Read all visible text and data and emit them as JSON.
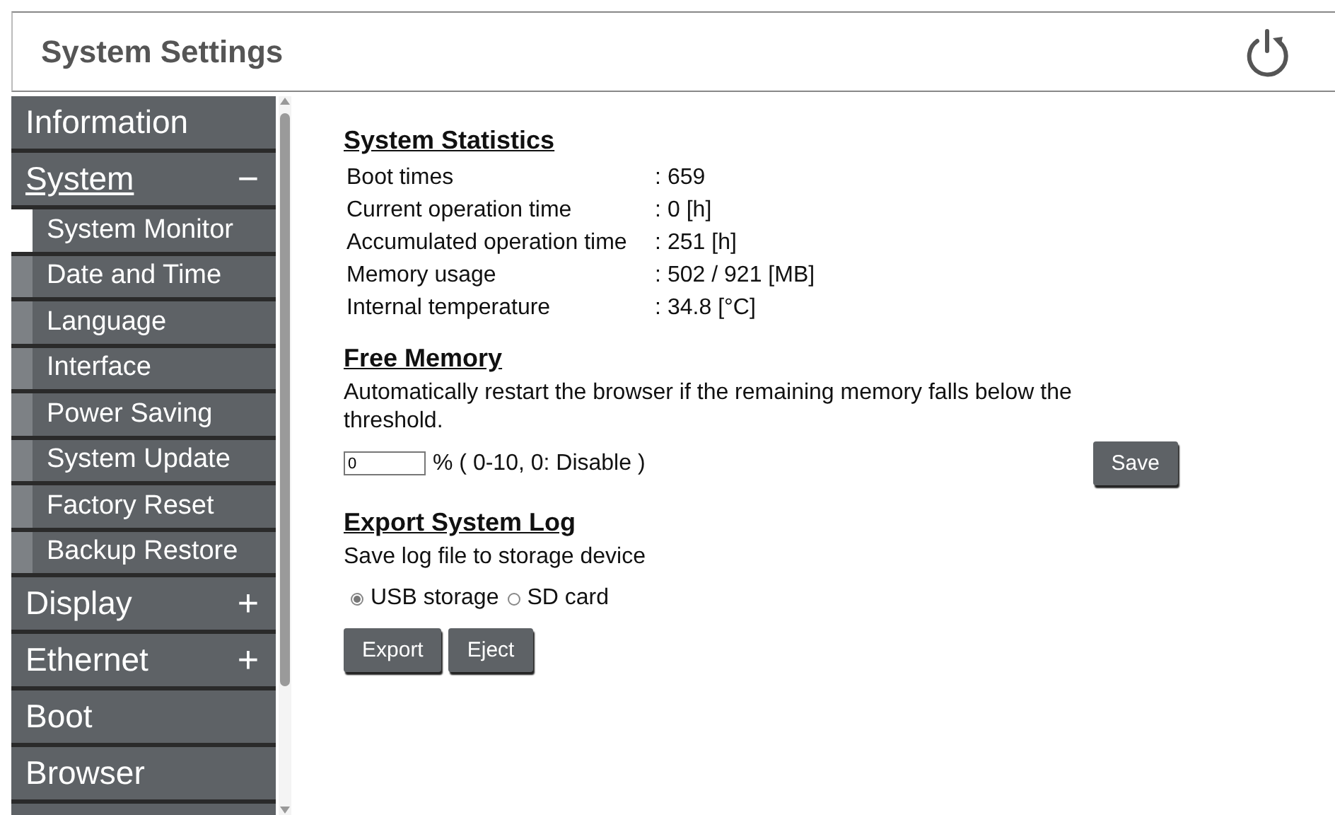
{
  "header": {
    "title": "System Settings"
  },
  "sidebar": {
    "items": [
      {
        "label": "Information",
        "selected": false
      },
      {
        "label": "System",
        "selected": true,
        "toggle": "−",
        "children": [
          {
            "label": "System Monitor",
            "selected": true
          },
          {
            "label": "Date and Time",
            "selected": false
          },
          {
            "label": "Language",
            "selected": false
          },
          {
            "label": "Interface",
            "selected": false
          },
          {
            "label": "Power Saving",
            "selected": false
          },
          {
            "label": "System Update",
            "selected": false
          },
          {
            "label": "Factory Reset",
            "selected": false
          },
          {
            "label": "Backup Restore",
            "selected": false
          }
        ]
      },
      {
        "label": "Display",
        "selected": false,
        "toggle": "+"
      },
      {
        "label": "Ethernet",
        "selected": false,
        "toggle": "+"
      },
      {
        "label": "Boot",
        "selected": false
      },
      {
        "label": "Browser",
        "selected": false
      }
    ]
  },
  "statistics": {
    "heading": "System Statistics",
    "rows": [
      {
        "label": "Boot times",
        "separator": ":",
        "value": "659"
      },
      {
        "label": "Current operation time",
        "separator": ":",
        "value": "0 [h]"
      },
      {
        "label": "Accumulated operation time",
        "separator": ":",
        "value": "251 [h]"
      },
      {
        "label": "Memory usage",
        "separator": ":",
        "value": "502 / 921 [MB]"
      },
      {
        "label": "Internal temperature",
        "separator": ":",
        "value": "34.8 [°C]"
      }
    ]
  },
  "free_memory": {
    "heading": "Free Memory",
    "description": "Automatically restart the browser if the remaining memory falls below the threshold.",
    "threshold": {
      "value": "0"
    },
    "range_hint": "% ( 0-10, 0: Disable )",
    "button": "Save"
  },
  "export_log": {
    "heading": "Export System Log",
    "description": "Save log file to storage device",
    "options": [
      {
        "label": "USB storage",
        "selected": true
      },
      {
        "label": "SD card",
        "selected": false
      }
    ],
    "buttons": [
      "Export",
      "Eject"
    ]
  }
}
